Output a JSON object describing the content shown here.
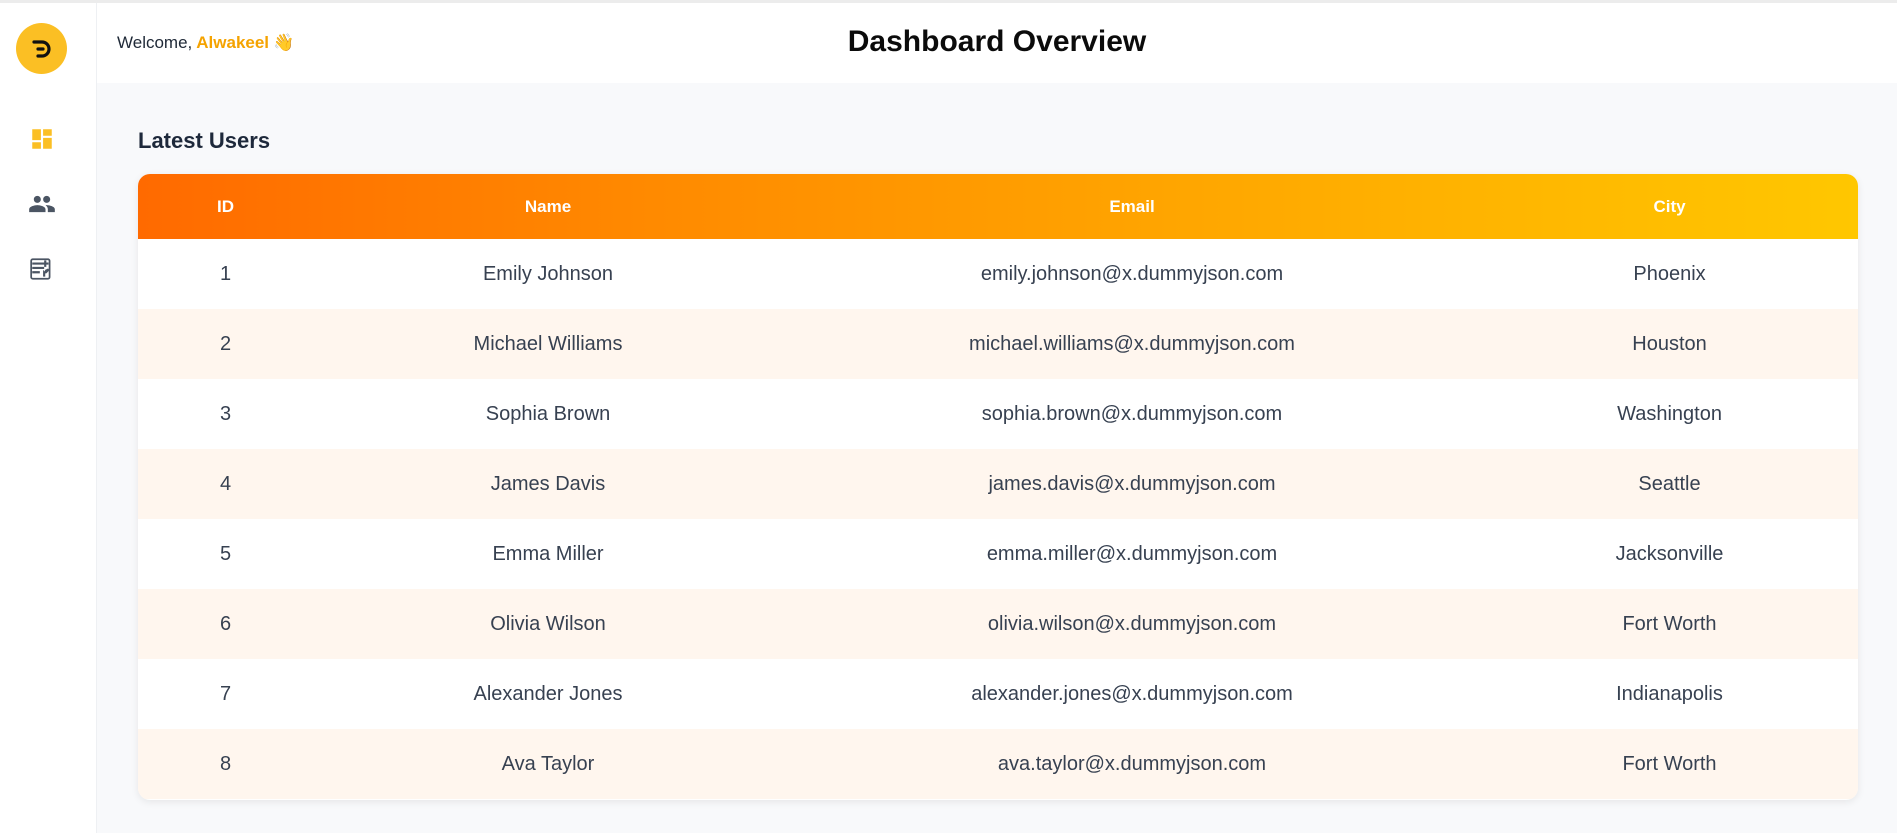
{
  "header": {
    "welcome_prefix": "Welcome,",
    "username": "Alwakeel",
    "wave_emoji": "👋",
    "title": "Dashboard Overview"
  },
  "sidebar": {
    "logo_letter": "D",
    "items": [
      {
        "icon": "dashboard-icon",
        "active": true
      },
      {
        "icon": "users-icon",
        "active": false
      },
      {
        "icon": "posts-icon",
        "active": false
      }
    ]
  },
  "section": {
    "title": "Latest Users"
  },
  "table": {
    "columns": [
      "ID",
      "Name",
      "Email",
      "City"
    ],
    "rows": [
      {
        "id": "1",
        "name": "Emily Johnson",
        "email": "emily.johnson@x.dummyjson.com",
        "city": "Phoenix"
      },
      {
        "id": "2",
        "name": "Michael Williams",
        "email": "michael.williams@x.dummyjson.com",
        "city": "Houston"
      },
      {
        "id": "3",
        "name": "Sophia Brown",
        "email": "sophia.brown@x.dummyjson.com",
        "city": "Washington"
      },
      {
        "id": "4",
        "name": "James Davis",
        "email": "james.davis@x.dummyjson.com",
        "city": "Seattle"
      },
      {
        "id": "5",
        "name": "Emma Miller",
        "email": "emma.miller@x.dummyjson.com",
        "city": "Jacksonville"
      },
      {
        "id": "6",
        "name": "Olivia Wilson",
        "email": "olivia.wilson@x.dummyjson.com",
        "city": "Fort Worth"
      },
      {
        "id": "7",
        "name": "Alexander Jones",
        "email": "alexander.jones@x.dummyjson.com",
        "city": "Indianapolis"
      },
      {
        "id": "8",
        "name": "Ava Taylor",
        "email": "ava.taylor@x.dummyjson.com",
        "city": "Fort Worth"
      }
    ]
  },
  "colors": {
    "accent": "#fbbf24",
    "username": "#f5a300",
    "header_gradient_start": "#ff6a00",
    "header_gradient_end": "#ffc700",
    "row_alt": "#fff6ee",
    "icon_muted": "#4b5563"
  }
}
